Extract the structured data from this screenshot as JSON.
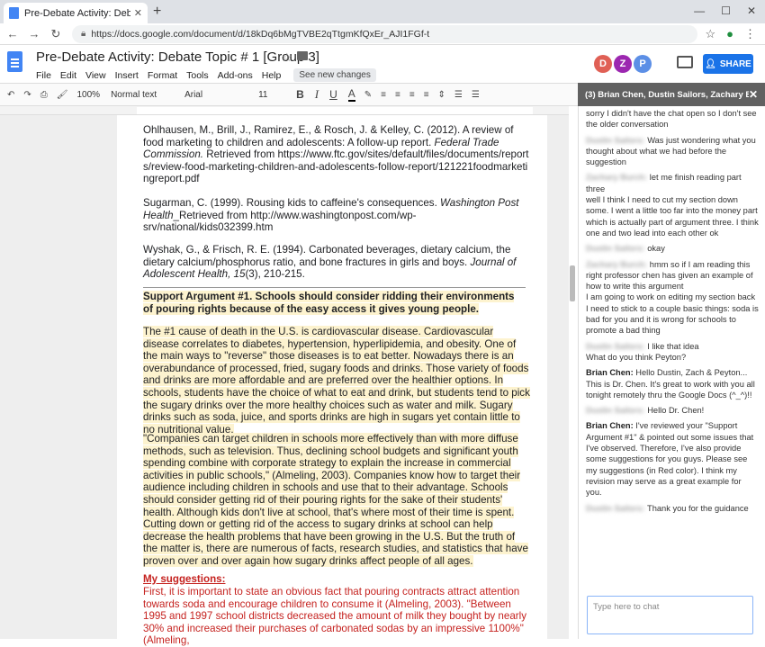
{
  "browser": {
    "tab_title": "Pre-Debate Activity: Debate Topic",
    "url": "https://docs.google.com/document/d/18kDq6bMgTVBE2qTtgmKfQxEr_AJI1FGf-t"
  },
  "doc": {
    "title": "Pre-Debate Activity: Debate Topic # 1 [Group 3]",
    "menu": [
      "File",
      "Edit",
      "View",
      "Insert",
      "Format",
      "Tools",
      "Add-ons",
      "Help"
    ],
    "see_new_changes": "See new changes",
    "share_label": "SHARE",
    "avatars": [
      {
        "letter": "D",
        "color": "#e06055"
      },
      {
        "letter": "Z",
        "color": "#9c27b0"
      },
      {
        "letter": "P",
        "color": "#5c8fe6"
      }
    ]
  },
  "toolbar": {
    "zoom": "100%",
    "style": "Normal text",
    "font": "Arial",
    "size": "11"
  },
  "references": [
    {
      "pre": "Ohlhausen, M., Brill, J., Ramirez, E., & Rosch, J. & Kelley, C. (2012). A review of food marketing to children and adolescents: A follow-up report. ",
      "em": "Federal Trade Commission.",
      "post": " Retrieved from https://www.ftc.gov/sites/default/files/documents/reports/review-food-marketing-children-and-adolescents-follow-report/121221foodmarketingreport.pdf"
    },
    {
      "pre": "Sugarman, C. (1999). Rousing kids to caffeine's consequences. ",
      "em": "Washington Post Health",
      "post": "_Retrieved from http://www.washingtonpost.com/wp-srv/national/kids032399.htm"
    },
    {
      "pre": "Wyshak, G., & Frisch, R. E. (1994). Carbonated beverages, dietary calcium, the dietary calcium/phosphorus ratio, and bone fractures in girls and boys. ",
      "em": "Journal of Adolescent Health, 15",
      "post": "(3), 210-215."
    }
  ],
  "argument": {
    "heading": "Support Argument #1. Schools should consider ridding their environments of pouring rights because of the easy access it gives young people.",
    "para1": "The #1 cause of death in the U.S. is cardiovascular disease. Cardiovascular disease correlates to diabetes, hypertension, hyperlipidemia, and obesity. One of the main ways to \"reverse\" those diseases is to eat better. Nowadays there is an overabundance of processed, fried, sugary foods and drinks. Those variety of foods and drinks are more affordable and are preferred over the healthier options. In schools, students have the choice of what to eat and drink, but students tend to pick the sugary drinks over the more healthy choices such as water and milk. Sugary drinks such as soda, juice, and sports drinks are high in sugars yet contain little to no nutritional value.",
    "para2": "\"Companies can target children in schools more effectively than with more diffuse methods, such as television. Thus, declining school budgets and significant youth spending combine with corporate strategy to explain the increase in commercial activities in public schools,\" (Almeling, 2003). Companies know how to target their audience including children in schools and use that to their advantage. Schools should consider getting rid of their pouring rights for the sake of their students' health. Although kids don't live at school, that's where most of their time is spent. Cutting down or getting rid of the access to sugary drinks at school can help decrease  the health problems that have been growing in the U.S. But the truth of the matter is, there are numerous of facts, research studies, and statistics that have proven over and over again how sugary drinks affect people of all ages."
  },
  "suggestions": {
    "heading": "My suggestions:",
    "text": "First, it is important to state an obvious fact that pouring contracts attract attention towards soda and encourage children to consume it (Almeling, 2003). \"Between 1995 and 1997 school districts decreased the amount of milk they bought by nearly 30% and increased their purchases of carbonated sodas by an impressive 1100%\" (Almeling,"
  },
  "chat": {
    "header": "(3) Brian Chen, Dustin Sailors, Zachary B...",
    "messages": [
      {
        "name": "",
        "text": "sorry I didn't have the chat open so I don't see the older conversation"
      },
      {
        "name": "Dustin Sailors:",
        "text": "Was just wondering what you thought about what we had before the suggestion"
      },
      {
        "name": "Zachary Burch:",
        "text": "let me finish reading part three\nwell I think I need to cut my section down some. I went a little too far into the money part which is actually part of argument three. I think one and two lead into each other ok"
      },
      {
        "name": "Dustin Sailors:",
        "text": "okay"
      },
      {
        "name": "Zachary Burch:",
        "text": "hmm so if I am reading this right professor chen has given an example of how to write this argument\nI am going to work on editing my section back\nI need to stick to a couple basic things: soda is bad for you and it is wrong for schools to promote a bad thing"
      },
      {
        "name": "Dustin Sailors:",
        "text": "I like that idea\nWhat do you think Peyton?"
      },
      {
        "name": "Brian Chen:",
        "text": "Hello Dustin, Zach & Peyton... This is Dr. Chen. It's great to work with you all tonight remotely thru the Google Docs (^_^)!!"
      },
      {
        "name": "Dustin Sailors:",
        "text": "Hello Dr. Chen!"
      },
      {
        "name": "Brian Chen:",
        "text": "I've reviewed your \"Support Argument #1\" & pointed out some issues that I've observed. Therefore, I've also provide some suggestions for you guys. Please see my suggestions (in Red color). I think my revision may serve as a great example for you."
      },
      {
        "name": "Dustin Sailors:",
        "text": "Thank you for the guidance"
      }
    ],
    "input_placeholder": "Type here to chat"
  }
}
